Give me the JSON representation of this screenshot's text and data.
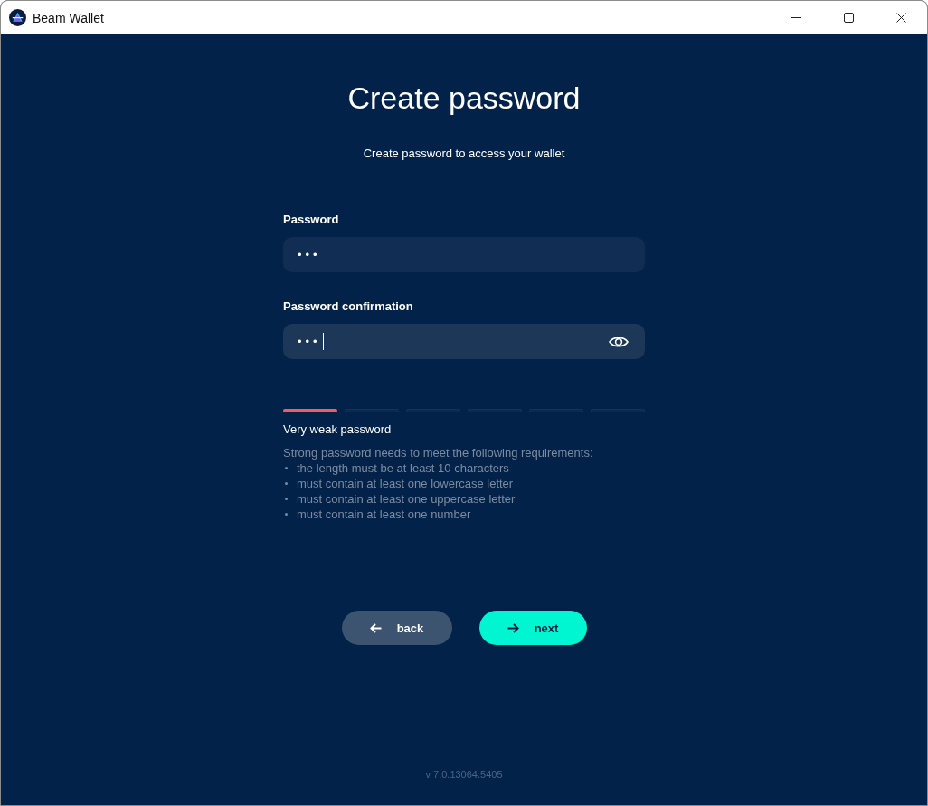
{
  "window": {
    "title": "Beam Wallet"
  },
  "page": {
    "title": "Create password",
    "subtitle": "Create password to access your wallet"
  },
  "fields": [
    {
      "label": "Password",
      "value": "•••",
      "focused": false
    },
    {
      "label": "Password confirmation",
      "value": "•••",
      "focused": true
    }
  ],
  "strength": {
    "segments": [
      {
        "on": true
      },
      {
        "on": false
      },
      {
        "on": false
      },
      {
        "on": false
      },
      {
        "on": false
      },
      {
        "on": false
      }
    ],
    "label": "Very weak password"
  },
  "requirements": {
    "intro": "Strong password needs to meet the following requirements:",
    "items": [
      "the length must be at least 10 characters",
      "must contain at least one lowercase letter",
      "must contain at least one uppercase letter",
      "must contain at least one number"
    ]
  },
  "buttons": [
    {
      "kind": "back",
      "label": "back"
    },
    {
      "kind": "next",
      "label": "next"
    }
  ],
  "version": "v 7.0.13064.5405"
}
